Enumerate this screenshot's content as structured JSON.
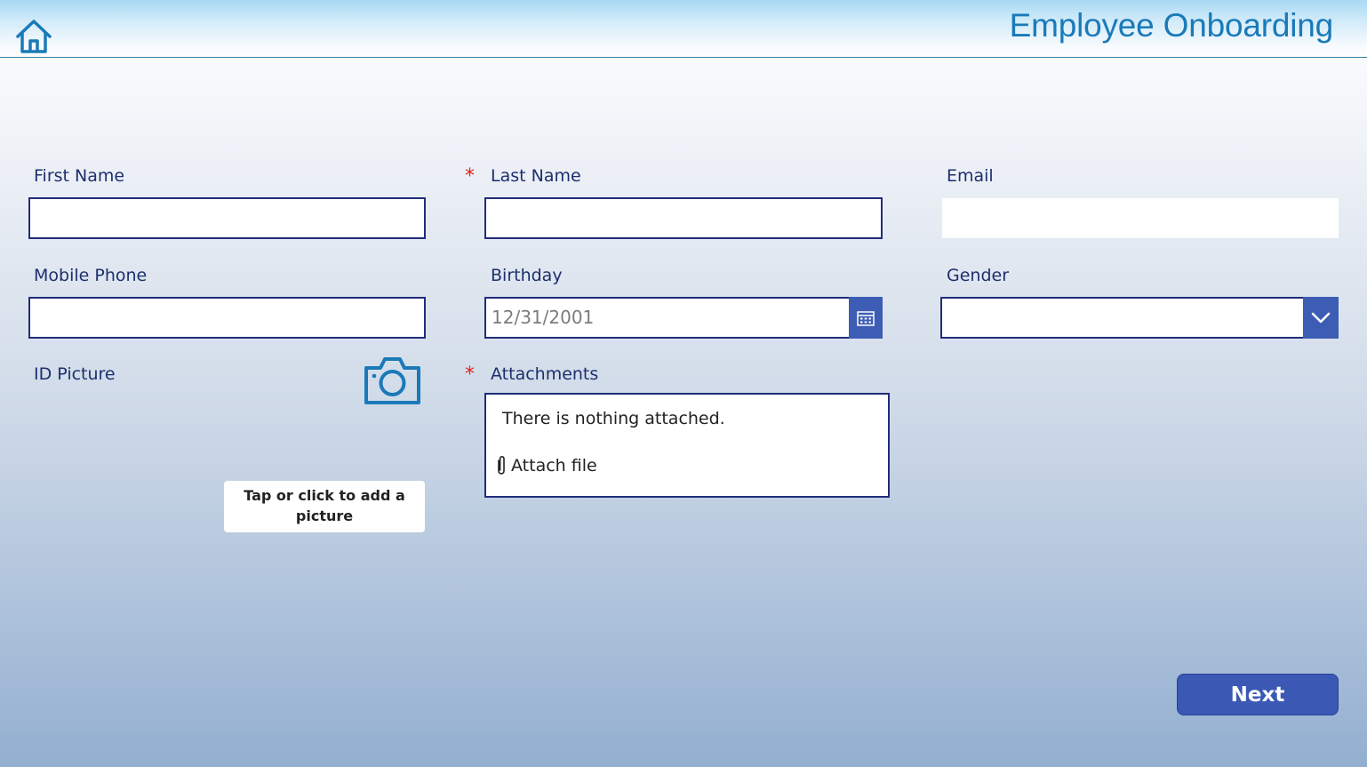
{
  "header": {
    "title": "Employee Onboarding"
  },
  "form": {
    "first_name": {
      "label": "First Name",
      "value": ""
    },
    "last_name": {
      "label": "Last Name",
      "required_mark": "*",
      "value": ""
    },
    "email": {
      "label": "Email",
      "value": ""
    },
    "mobile_phone": {
      "label": "Mobile Phone",
      "value": ""
    },
    "birthday": {
      "label": "Birthday",
      "placeholder": "12/31/2001"
    },
    "gender": {
      "label": "Gender",
      "selected": ""
    },
    "id_picture": {
      "label": "ID Picture",
      "add_prompt": "Tap or click to add a picture"
    },
    "attachments": {
      "label": "Attachments",
      "required_mark": "*",
      "empty_text": "There is nothing attached.",
      "attach_label": "Attach file"
    }
  },
  "actions": {
    "next_label": "Next"
  },
  "icons": {
    "home": "home-icon",
    "calendar": "calendar-icon",
    "dropdown": "chevron-down-icon",
    "camera": "camera-icon",
    "attach": "paperclip-icon"
  },
  "colors": {
    "accent": "#3d5cb4",
    "title": "#1a7ab8",
    "label": "#1c2f6e",
    "required": "#e1251b",
    "field_border": "#1f2d7a"
  }
}
